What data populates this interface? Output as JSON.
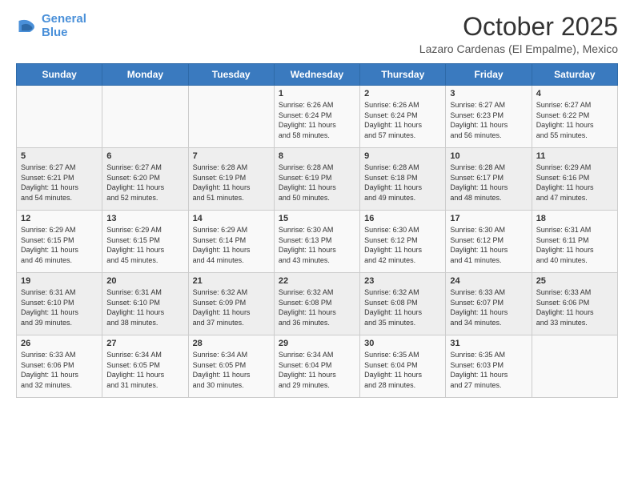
{
  "header": {
    "logo_line1": "General",
    "logo_line2": "Blue",
    "month": "October 2025",
    "location": "Lazaro Cardenas (El Empalme), Mexico"
  },
  "weekdays": [
    "Sunday",
    "Monday",
    "Tuesday",
    "Wednesday",
    "Thursday",
    "Friday",
    "Saturday"
  ],
  "weeks": [
    [
      {
        "day": "",
        "info": ""
      },
      {
        "day": "",
        "info": ""
      },
      {
        "day": "",
        "info": ""
      },
      {
        "day": "1",
        "info": "Sunrise: 6:26 AM\nSunset: 6:24 PM\nDaylight: 11 hours\nand 58 minutes."
      },
      {
        "day": "2",
        "info": "Sunrise: 6:26 AM\nSunset: 6:24 PM\nDaylight: 11 hours\nand 57 minutes."
      },
      {
        "day": "3",
        "info": "Sunrise: 6:27 AM\nSunset: 6:23 PM\nDaylight: 11 hours\nand 56 minutes."
      },
      {
        "day": "4",
        "info": "Sunrise: 6:27 AM\nSunset: 6:22 PM\nDaylight: 11 hours\nand 55 minutes."
      }
    ],
    [
      {
        "day": "5",
        "info": "Sunrise: 6:27 AM\nSunset: 6:21 PM\nDaylight: 11 hours\nand 54 minutes."
      },
      {
        "day": "6",
        "info": "Sunrise: 6:27 AM\nSunset: 6:20 PM\nDaylight: 11 hours\nand 52 minutes."
      },
      {
        "day": "7",
        "info": "Sunrise: 6:28 AM\nSunset: 6:19 PM\nDaylight: 11 hours\nand 51 minutes."
      },
      {
        "day": "8",
        "info": "Sunrise: 6:28 AM\nSunset: 6:19 PM\nDaylight: 11 hours\nand 50 minutes."
      },
      {
        "day": "9",
        "info": "Sunrise: 6:28 AM\nSunset: 6:18 PM\nDaylight: 11 hours\nand 49 minutes."
      },
      {
        "day": "10",
        "info": "Sunrise: 6:28 AM\nSunset: 6:17 PM\nDaylight: 11 hours\nand 48 minutes."
      },
      {
        "day": "11",
        "info": "Sunrise: 6:29 AM\nSunset: 6:16 PM\nDaylight: 11 hours\nand 47 minutes."
      }
    ],
    [
      {
        "day": "12",
        "info": "Sunrise: 6:29 AM\nSunset: 6:15 PM\nDaylight: 11 hours\nand 46 minutes."
      },
      {
        "day": "13",
        "info": "Sunrise: 6:29 AM\nSunset: 6:15 PM\nDaylight: 11 hours\nand 45 minutes."
      },
      {
        "day": "14",
        "info": "Sunrise: 6:29 AM\nSunset: 6:14 PM\nDaylight: 11 hours\nand 44 minutes."
      },
      {
        "day": "15",
        "info": "Sunrise: 6:30 AM\nSunset: 6:13 PM\nDaylight: 11 hours\nand 43 minutes."
      },
      {
        "day": "16",
        "info": "Sunrise: 6:30 AM\nSunset: 6:12 PM\nDaylight: 11 hours\nand 42 minutes."
      },
      {
        "day": "17",
        "info": "Sunrise: 6:30 AM\nSunset: 6:12 PM\nDaylight: 11 hours\nand 41 minutes."
      },
      {
        "day": "18",
        "info": "Sunrise: 6:31 AM\nSunset: 6:11 PM\nDaylight: 11 hours\nand 40 minutes."
      }
    ],
    [
      {
        "day": "19",
        "info": "Sunrise: 6:31 AM\nSunset: 6:10 PM\nDaylight: 11 hours\nand 39 minutes."
      },
      {
        "day": "20",
        "info": "Sunrise: 6:31 AM\nSunset: 6:10 PM\nDaylight: 11 hours\nand 38 minutes."
      },
      {
        "day": "21",
        "info": "Sunrise: 6:32 AM\nSunset: 6:09 PM\nDaylight: 11 hours\nand 37 minutes."
      },
      {
        "day": "22",
        "info": "Sunrise: 6:32 AM\nSunset: 6:08 PM\nDaylight: 11 hours\nand 36 minutes."
      },
      {
        "day": "23",
        "info": "Sunrise: 6:32 AM\nSunset: 6:08 PM\nDaylight: 11 hours\nand 35 minutes."
      },
      {
        "day": "24",
        "info": "Sunrise: 6:33 AM\nSunset: 6:07 PM\nDaylight: 11 hours\nand 34 minutes."
      },
      {
        "day": "25",
        "info": "Sunrise: 6:33 AM\nSunset: 6:06 PM\nDaylight: 11 hours\nand 33 minutes."
      }
    ],
    [
      {
        "day": "26",
        "info": "Sunrise: 6:33 AM\nSunset: 6:06 PM\nDaylight: 11 hours\nand 32 minutes."
      },
      {
        "day": "27",
        "info": "Sunrise: 6:34 AM\nSunset: 6:05 PM\nDaylight: 11 hours\nand 31 minutes."
      },
      {
        "day": "28",
        "info": "Sunrise: 6:34 AM\nSunset: 6:05 PM\nDaylight: 11 hours\nand 30 minutes."
      },
      {
        "day": "29",
        "info": "Sunrise: 6:34 AM\nSunset: 6:04 PM\nDaylight: 11 hours\nand 29 minutes."
      },
      {
        "day": "30",
        "info": "Sunrise: 6:35 AM\nSunset: 6:04 PM\nDaylight: 11 hours\nand 28 minutes."
      },
      {
        "day": "31",
        "info": "Sunrise: 6:35 AM\nSunset: 6:03 PM\nDaylight: 11 hours\nand 27 minutes."
      },
      {
        "day": "",
        "info": ""
      }
    ]
  ]
}
